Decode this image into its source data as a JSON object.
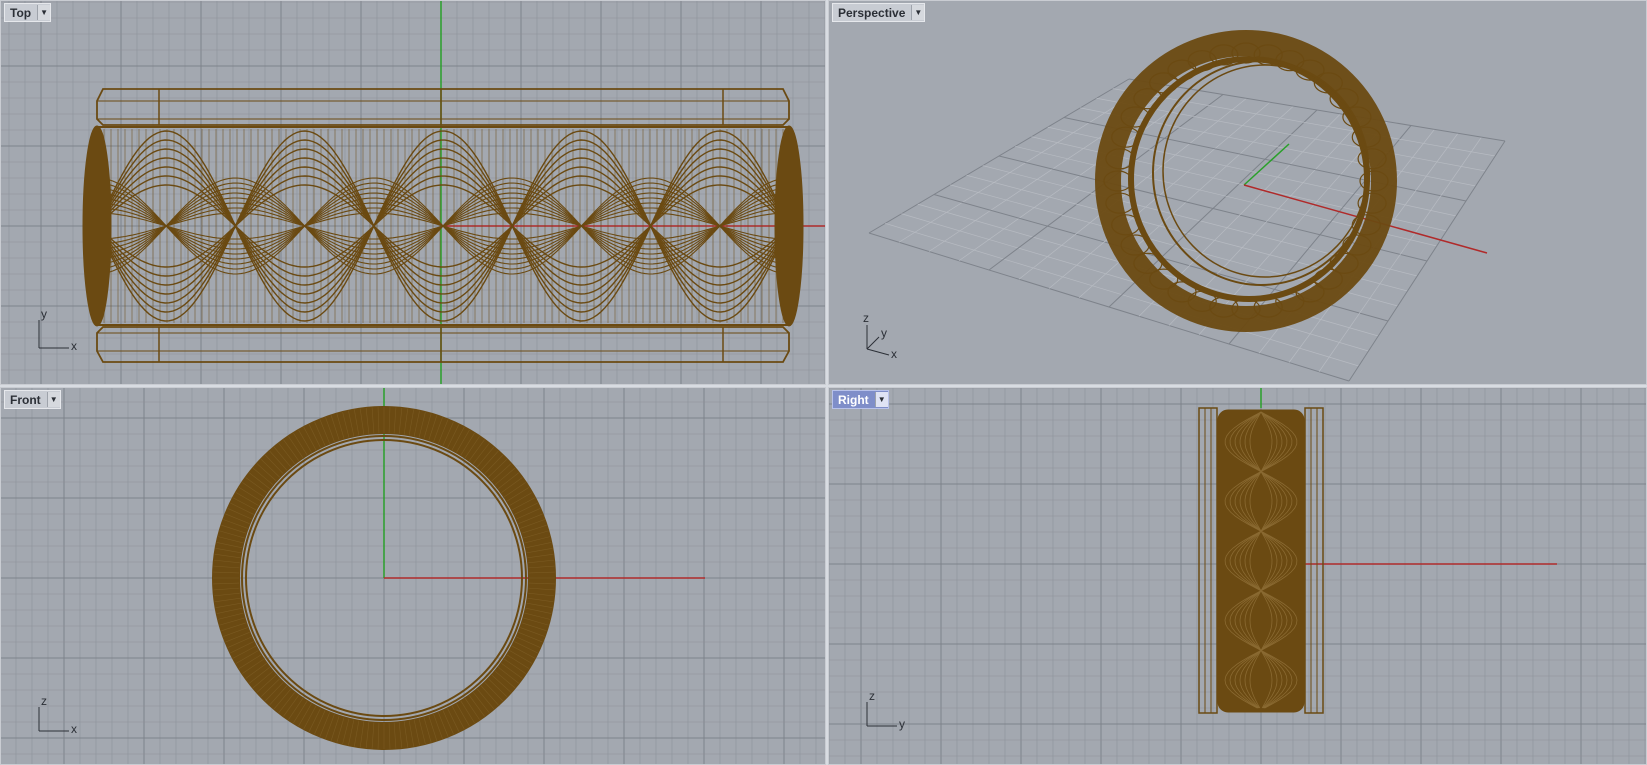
{
  "viewports": {
    "top": {
      "label": "Top",
      "active": false,
      "axes": [
        "y",
        "x"
      ]
    },
    "persp": {
      "label": "Perspective",
      "active": false,
      "axes": [
        "z",
        "y",
        "x"
      ]
    },
    "front": {
      "label": "Front",
      "active": false,
      "axes": [
        "z",
        "x"
      ]
    },
    "right": {
      "label": "Right",
      "active": true,
      "axes": [
        "z",
        "y"
      ]
    }
  },
  "icons": {
    "dropdown": "dropdown-arrow-icon"
  },
  "colors": {
    "background": "#a3a8b0",
    "grid": "#8d929a",
    "grid_major": "#7e838b",
    "x_axis": "#b02a2a",
    "y_axis": "#2aa02a",
    "wire": "#6b4a12",
    "active_label": "#7f8ec9"
  }
}
